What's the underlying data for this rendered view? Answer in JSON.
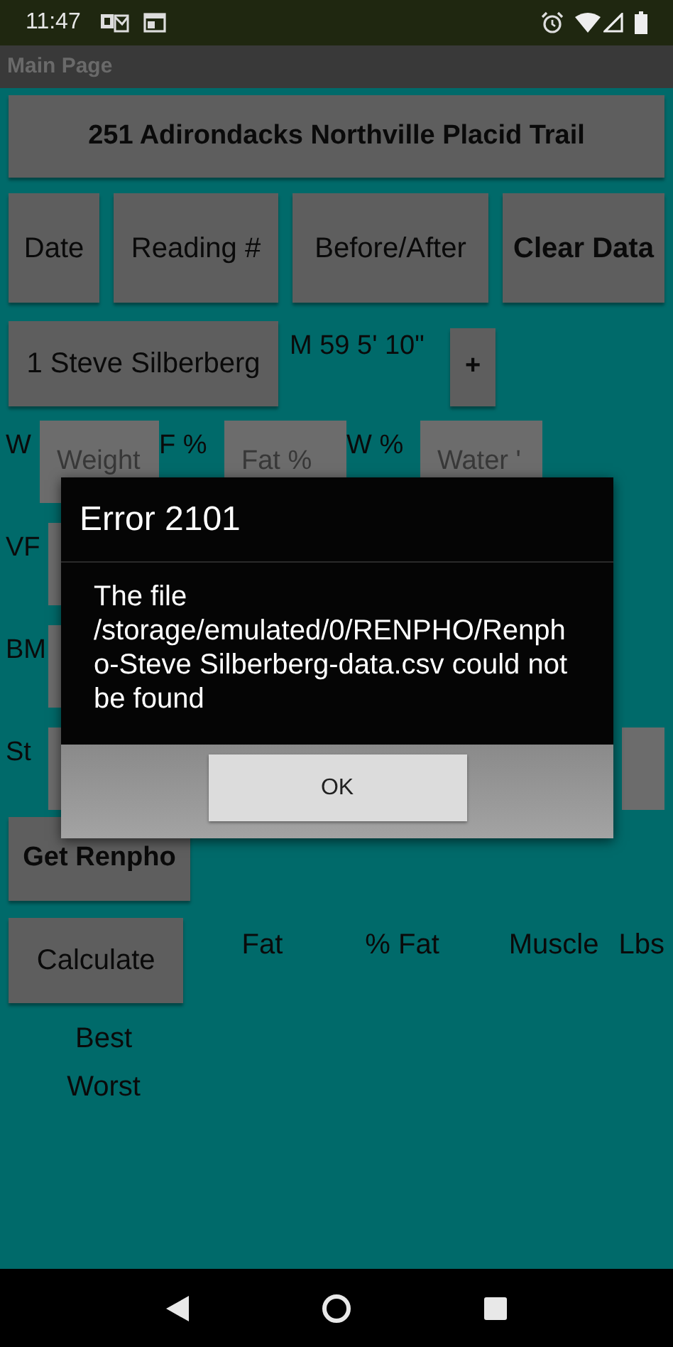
{
  "status_bar": {
    "time": "11:47"
  },
  "action_bar": {
    "title": "Main Page"
  },
  "trail_button": "251 Adirondacks Northville Placid Trail",
  "top_buttons": [
    {
      "label": "Date",
      "bold": false
    },
    {
      "label": "Reading #",
      "bold": false
    },
    {
      "label": "Before/After",
      "bold": false
    },
    {
      "label": "Clear Data",
      "bold": true
    }
  ],
  "profile": {
    "user_button": "1 Steve Silberberg",
    "info": "M 59 5' 10\"",
    "add_button": "+"
  },
  "measure_rows": [
    {
      "items": [
        {
          "kind": "label",
          "text": "W"
        },
        {
          "kind": "field",
          "placeholder": "Weight"
        },
        {
          "kind": "label",
          "text": "F %"
        },
        {
          "kind": "field",
          "placeholder": "Fat %"
        },
        {
          "kind": "label",
          "text": "W %"
        },
        {
          "kind": "field",
          "placeholder": "Water '"
        }
      ]
    },
    {
      "items": [
        {
          "kind": "label",
          "text": "VF"
        },
        {
          "kind": "field"
        }
      ]
    },
    {
      "items": [
        {
          "kind": "label",
          "text": "BM"
        },
        {
          "kind": "field"
        }
      ]
    },
    {
      "items": [
        {
          "kind": "label",
          "text": "St"
        },
        {
          "kind": "field"
        },
        {
          "kind": "field"
        }
      ]
    }
  ],
  "dialog": {
    "title": "Error 2101",
    "message": "The file /storage/emulated/0/RENPHO/Renpho-Steve Silberberg-data.csv could not be found",
    "button": "OK"
  },
  "get_renpho_button": "Get Renpho",
  "calculate_button": "Calculate",
  "result_headers": [
    "Fat",
    "% Fat",
    "Muscle",
    "Lbs"
  ],
  "result_rows": [
    "Best",
    "Worst"
  ]
}
